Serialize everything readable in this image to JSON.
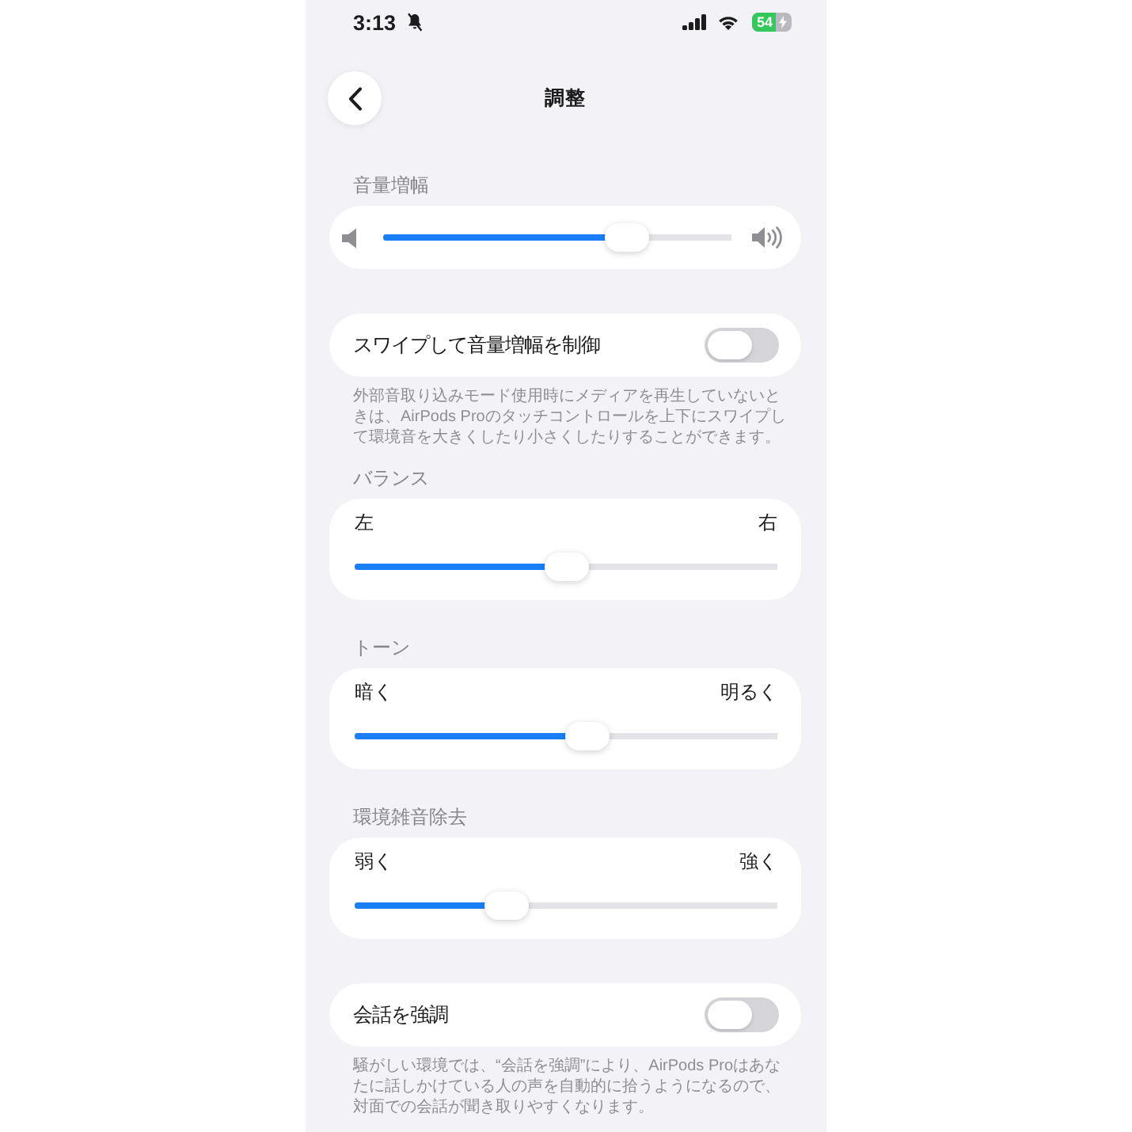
{
  "status_bar": {
    "time": "3:13",
    "battery": "54"
  },
  "header": {
    "title": "調整"
  },
  "sections": [
    {
      "kind": "volume",
      "label": "音量増幅",
      "level": 0.7
    },
    {
      "kind": "toggle",
      "label": "スワイプして音量増幅を制御",
      "on": false,
      "description": "外部音取り込みモード使用時にメディアを再生していないときは、AirPods Proのタッチコントロールを上下にスワイプして環境音を大きくしたり小さくしたりすることができます。"
    },
    {
      "kind": "range",
      "label": "バランス",
      "min_label": "左",
      "max_label": "右",
      "level": 0.5
    },
    {
      "kind": "range",
      "label": "トーン",
      "min_label": "暗く",
      "max_label": "明るく",
      "level": 0.55
    },
    {
      "kind": "range",
      "label": "環境雑音除去",
      "min_label": "弱く",
      "max_label": "強く",
      "level": 0.36
    },
    {
      "kind": "toggle",
      "label": "会話を強調",
      "on": false,
      "description": "騒がしい環境では、“会話を強調”により、AirPods Proはあなたに話しかけている人の声を自動的に拾うようになるので、対面での会話が聞き取りやすくなります。"
    }
  ]
}
